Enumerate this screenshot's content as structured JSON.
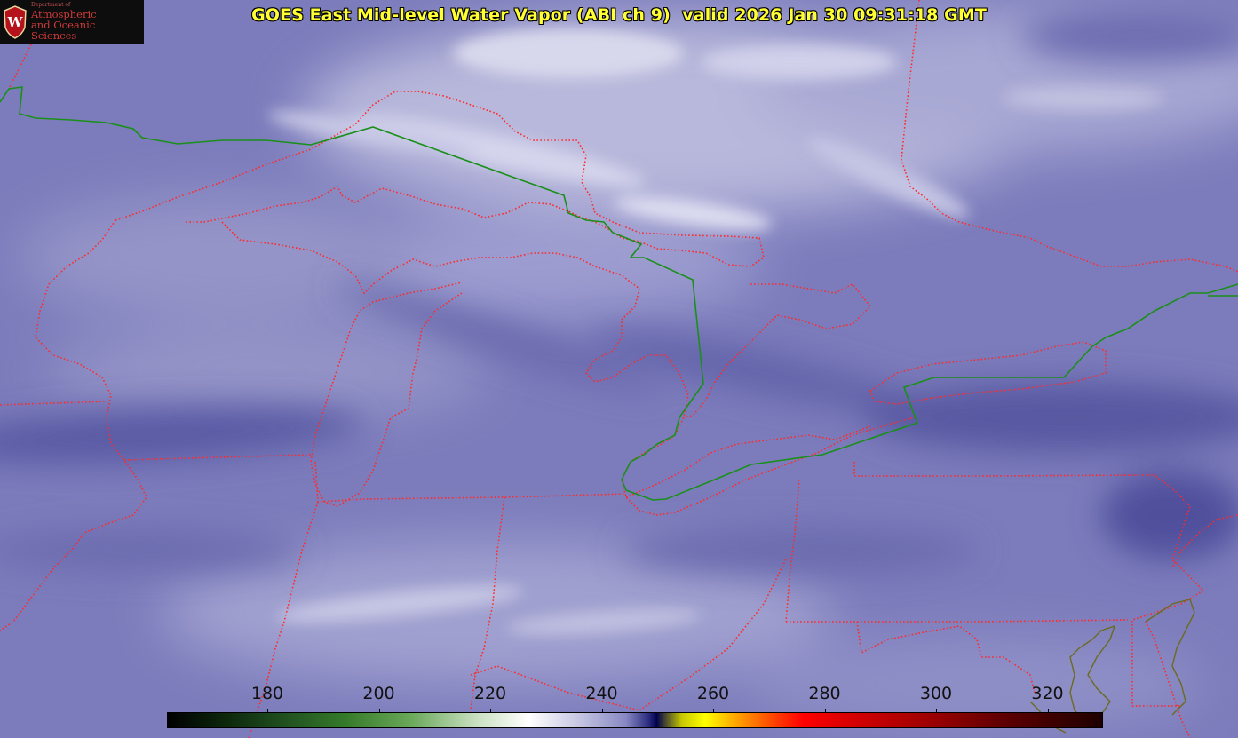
{
  "title": "GOES East Mid-level Water Vapor (ABI ch 9)  valid 2026 Jan 30 09:31:18 GMT",
  "logo": {
    "dept": "Department of",
    "line1": "Atmospheric",
    "line2": "and Oceanic Sciences"
  },
  "colorbar": {
    "labels": [
      "180",
      "200",
      "220",
      "240",
      "260",
      "280",
      "300",
      "320"
    ]
  },
  "colors": {
    "state_borders": "#ff2a2a",
    "international_border": "#1a8f1a",
    "title_text": "#ffff33",
    "vapor_base": "#7c7cbc"
  }
}
